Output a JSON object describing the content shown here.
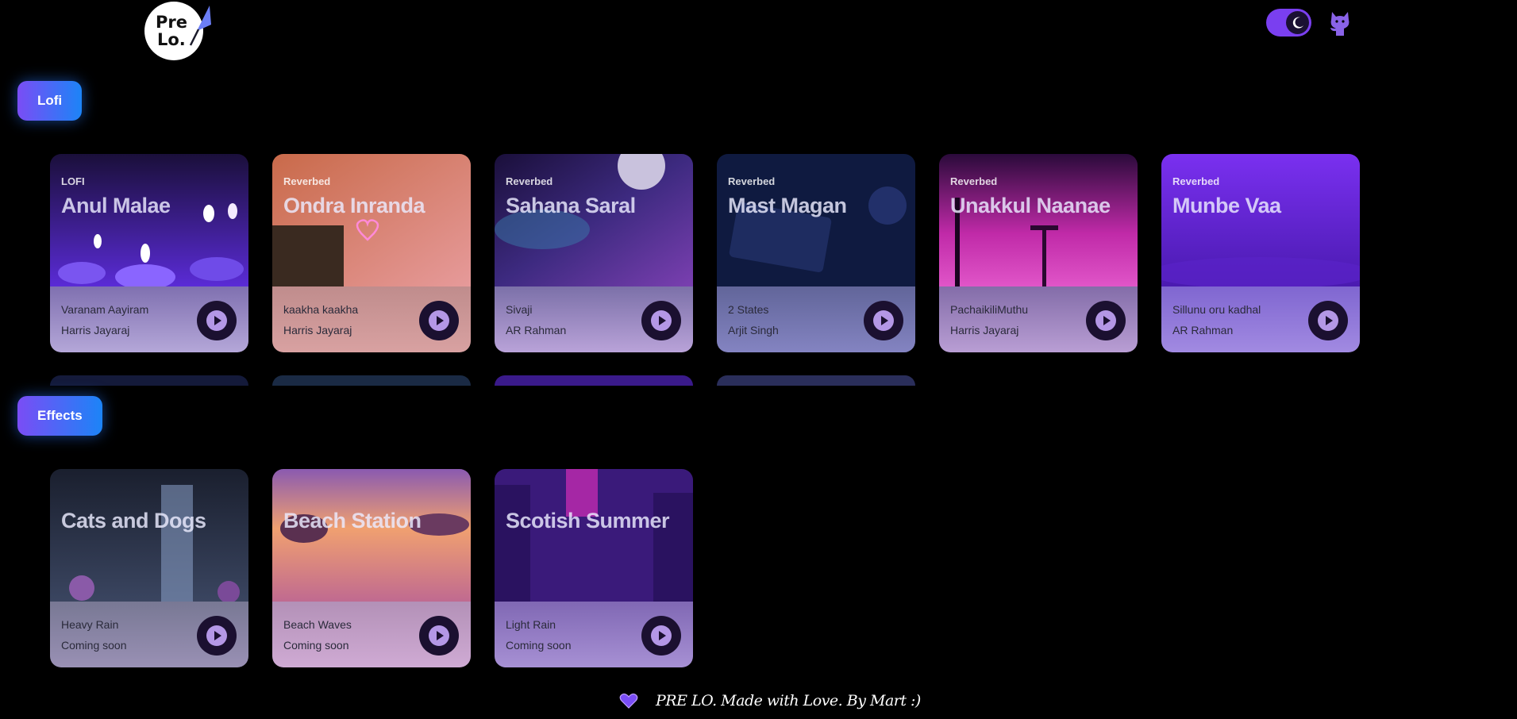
{
  "header": {
    "logo_line1": "Pre",
    "logo_line2": "Lo."
  },
  "sections": {
    "lofi_label": "Lofi",
    "effects_label": "Effects"
  },
  "lofi_cards": [
    {
      "tag": "LOFI",
      "title": "Anul Malae",
      "line1": "Varanam Aayiram",
      "line2": "Harris Jayaraj"
    },
    {
      "tag": "Reverbed",
      "title": "Ondra Inranda",
      "line1": "kaakha kaakha",
      "line2": "Harris Jayaraj"
    },
    {
      "tag": "Reverbed",
      "title": "Sahana Saral",
      "line1": "Sivaji",
      "line2": "AR Rahman"
    },
    {
      "tag": "Reverbed",
      "title": "Mast Magan",
      "line1": "2 States",
      "line2": "Arjit Singh"
    },
    {
      "tag": "Reverbed",
      "title": "Unakkul Naanae",
      "line1": "PachaikiliMuthu",
      "line2": "Harris Jayaraj"
    },
    {
      "tag": "Reverbed",
      "title": "Munbe Vaa",
      "line1": "Sillunu oru kadhal",
      "line2": "AR Rahman"
    }
  ],
  "effect_cards": [
    {
      "title": "Cats and Dogs",
      "line1": "Heavy Rain",
      "line2": "Coming soon"
    },
    {
      "title": "Beach Station",
      "line1": "Beach Waves",
      "line2": "Coming soon"
    },
    {
      "title": "Scotish Summer",
      "line1": "Light Rain",
      "line2": "Coming soon"
    }
  ],
  "footer": {
    "text": "PRE LO. Made with Love. By Mart :)"
  },
  "colors": {
    "background": "#000000",
    "accent_purple": "#7a3ff0",
    "accent_blue": "#1c84f7"
  },
  "icons": {
    "theme": "moon-icon",
    "github": "github-cat-icon",
    "play": "play-icon",
    "footer": "heart-icon"
  }
}
